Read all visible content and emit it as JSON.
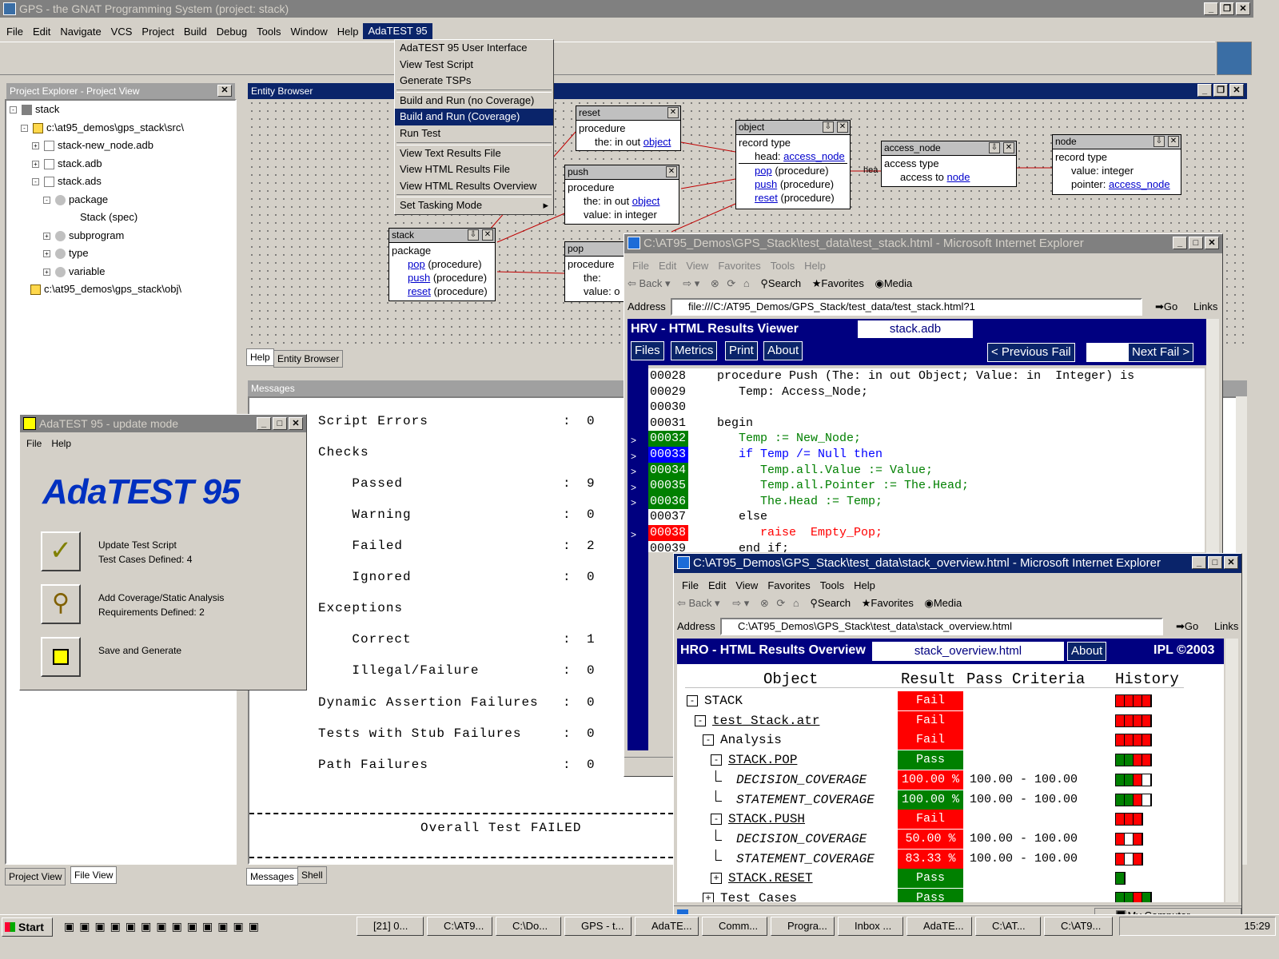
{
  "gps": {
    "title": "GPS - the GNAT Programming System (project: stack)",
    "menu": [
      "File",
      "Edit",
      "Navigate",
      "VCS",
      "Project",
      "Build",
      "Debug",
      "Tools",
      "Window",
      "Help",
      "AdaTEST 95"
    ]
  },
  "adatest_menu": {
    "items": [
      "AdaTEST 95 User Interface",
      "View Test Script",
      "Generate TSPs",
      "Build and Run (no Coverage)",
      "Build and Run (Coverage)",
      "Run Test",
      "View Text Results File",
      "View HTML Results File",
      "View HTML Results Overview",
      "Set Tasking Mode"
    ]
  },
  "project_explorer": {
    "title": "Project Explorer - Project View",
    "tree": [
      "stack",
      "c:\\at95_demos\\gps_stack\\src\\",
      "stack-new_node.adb",
      "stack.adb",
      "stack.ads",
      "package",
      "Stack (spec)",
      "subprogram",
      "type",
      "variable",
      "c:\\at95_demos\\gps_stack\\obj\\"
    ],
    "tabs": [
      "Project View",
      "File View"
    ]
  },
  "entity_browser": {
    "title": "Entity Browser",
    "tabs": [
      "Help",
      "Entity Browser"
    ],
    "boxes": {
      "reset": {
        "name": "reset",
        "kind": "procedure",
        "p1": "the: in out ",
        "p1t": "object"
      },
      "push": {
        "name": "push",
        "kind": "procedure",
        "p1": "the:   in out ",
        "p1t": "object",
        "p2": "value: in integer"
      },
      "pop": {
        "name": "pop",
        "kind": "procedure",
        "p1": "the:",
        "p2": "value: o"
      },
      "stack": {
        "name": "stack",
        "kind": "package",
        "items": [
          "pop",
          "push",
          "reset"
        ],
        "suffix": "(procedure)"
      },
      "object": {
        "name": "object",
        "kind": "record type",
        "head": "head: ",
        "headt": "access_node",
        "items": [
          "pop",
          "push",
          "reset"
        ],
        "suffix": "(procedure)"
      },
      "access_node": {
        "name": "access_node",
        "kind": "access type",
        "to": "access to ",
        "tot": "node"
      },
      "node": {
        "name": "node",
        "kind": "record type",
        "v": "value:   integer",
        "p": "pointer: ",
        "pt": "access_node"
      },
      "edge_label": "hea"
    }
  },
  "messages": {
    "title": "Messages",
    "rows": [
      {
        "label": "Script Errors",
        "sep": ":",
        "val": "0"
      },
      {
        "label": "Checks",
        "sep": "",
        "val": ""
      },
      {
        "label": "    Passed",
        "sep": ":",
        "val": "9"
      },
      {
        "label": "    Warning",
        "sep": ":",
        "val": "0"
      },
      {
        "label": "    Failed",
        "sep": ":",
        "val": "2"
      },
      {
        "label": "    Ignored",
        "sep": ":",
        "val": "0"
      },
      {
        "label": "Exceptions",
        "sep": "",
        "val": ""
      },
      {
        "label": "    Correct",
        "sep": ":",
        "val": "1"
      },
      {
        "label": "    Illegal/Failure",
        "sep": ":",
        "val": "0"
      },
      {
        "label": "Dynamic Assertion Failures",
        "sep": ":",
        "val": "0"
      },
      {
        "label": "Tests with Stub Failures",
        "sep": ":",
        "val": "0"
      },
      {
        "label": "Path Failures",
        "sep": ":",
        "val": "0"
      }
    ],
    "overall": "Overall Test FAILED",
    "tabs": [
      "Messages",
      "Shell"
    ]
  },
  "adatest": {
    "title": "AdaTEST 95 - update mode",
    "menu": [
      "File",
      "Help"
    ],
    "logo": "AdaTEST 95",
    "actions": [
      {
        "l1": "Update Test Script",
        "l2": "Test Cases Defined: 4"
      },
      {
        "l1": "Add Coverage/Static Analysis",
        "l2": "Requirements Defined: 2"
      },
      {
        "l1": "Save and Generate",
        "l2": ""
      }
    ]
  },
  "ie1": {
    "title": "C:\\AT95_Demos\\GPS_Stack\\test_data\\test_stack.html - Microsoft Internet Explorer",
    "menu": [
      "File",
      "Edit",
      "View",
      "Favorites",
      "Tools",
      "Help"
    ],
    "tb": {
      "back": "Back",
      "search": "Search",
      "favorites": "Favorites",
      "media": "Media"
    },
    "address_label": "Address",
    "address": "file:///C:/AT95_Demos/GPS_Stack/test_data/test_stack.html?1",
    "go": "Go",
    "links": "Links",
    "hrv": "HRV - HTML Results Viewer",
    "file": "stack.adb",
    "buttons": [
      "Files",
      "Metrics",
      "Print",
      "About"
    ],
    "prev": "< Previous Fail",
    "next": "Next Fail >",
    "code": [
      {
        "n": "00028",
        "c": "",
        "t": "    procedure Push (The: in out Object; Value: in  Integer) is",
        "cls": ""
      },
      {
        "n": "00029",
        "c": "",
        "t": "       Temp: Access_Node;",
        "cls": ""
      },
      {
        "n": "00030",
        "c": "",
        "t": "",
        "cls": ""
      },
      {
        "n": "00031",
        "c": "",
        "t": "    begin",
        "cls": ""
      },
      {
        "n": "00032",
        "c": "g",
        "t": "       Temp := New_Node;",
        "cls": "gr"
      },
      {
        "n": "00033",
        "c": "b",
        "t": "       if Temp /= Null then",
        "cls": "kw"
      },
      {
        "n": "00034",
        "c": "g",
        "t": "          Temp.all.Value := Value;",
        "cls": "gr"
      },
      {
        "n": "00035",
        "c": "g",
        "t": "          Temp.all.Pointer := The.Head;",
        "cls": "gr"
      },
      {
        "n": "00036",
        "c": "g",
        "t": "          The.Head := Temp;",
        "cls": "gr"
      },
      {
        "n": "00037",
        "c": "",
        "t": "       else",
        "cls": ""
      },
      {
        "n": "00038",
        "c": "r",
        "t": "          raise  Empty_Pop;",
        "cls": "rd"
      },
      {
        "n": "00039",
        "c": "",
        "t": "       end if;",
        "cls": ""
      }
    ]
  },
  "ie2": {
    "title": "C:\\AT95_Demos\\GPS_Stack\\test_data\\stack_overview.html - Microsoft Internet Explorer",
    "menu": [
      "File",
      "Edit",
      "View",
      "Favorites",
      "Tools",
      "Help"
    ],
    "address": "C:\\AT95_Demos\\GPS_Stack\\test_data\\stack_overview.html",
    "hro": "HRO - HTML Results Overview",
    "file": "stack_overview.html",
    "about": "About",
    "ipl": "IPL ©2003",
    "headers": [
      "Object",
      "Result",
      "Pass Criteria",
      "History"
    ],
    "rows": [
      {
        "obj": "STACK",
        "res": "Fail",
        "pc": "",
        "ind": 0,
        "exp": "-",
        "rc": "f",
        "it": false,
        "hist": [
          "r",
          "r",
          "r",
          "r"
        ]
      },
      {
        "obj": "test_Stack.atr",
        "res": "Fail",
        "pc": "",
        "ind": 1,
        "exp": "-",
        "rc": "f",
        "it": false,
        "hist": [
          "r",
          "r",
          "r",
          "r"
        ]
      },
      {
        "obj": "Analysis",
        "res": "Fail",
        "pc": "",
        "ind": 2,
        "exp": "-",
        "rc": "f",
        "it": false,
        "hist": [
          "r",
          "r",
          "r",
          "r"
        ]
      },
      {
        "obj": "STACK.POP",
        "res": "Pass",
        "pc": "",
        "ind": 3,
        "exp": "-",
        "rc": "p",
        "it": false,
        "hist": [
          "g",
          "g",
          "r",
          "r"
        ]
      },
      {
        "obj": "DECISION_COVERAGE",
        "res": "100.00 %",
        "pc": "100.00  -  100.00",
        "ind": 4,
        "exp": "",
        "rc": "f",
        "it": true,
        "hist": [
          "g",
          "g",
          "r",
          "w"
        ]
      },
      {
        "obj": "STATEMENT_COVERAGE",
        "res": "100.00 %",
        "pc": "100.00  -  100.00",
        "ind": 4,
        "exp": "",
        "rc": "p",
        "it": true,
        "hist": [
          "g",
          "g",
          "r",
          "w"
        ]
      },
      {
        "obj": "STACK.PUSH",
        "res": "Fail",
        "pc": "",
        "ind": 3,
        "exp": "-",
        "rc": "f",
        "it": false,
        "hist": [
          "r",
          "r",
          "r"
        ]
      },
      {
        "obj": "DECISION_COVERAGE",
        "res": "50.00 %",
        "pc": "100.00  -  100.00",
        "ind": 4,
        "exp": "",
        "rc": "f",
        "it": true,
        "hist": [
          "r",
          "w",
          "r"
        ]
      },
      {
        "obj": "STATEMENT_COVERAGE",
        "res": "83.33 %",
        "pc": "100.00  -  100.00",
        "ind": 4,
        "exp": "",
        "rc": "f",
        "it": true,
        "hist": [
          "r",
          "w",
          "r"
        ]
      },
      {
        "obj": "STACK.RESET",
        "res": "Pass",
        "pc": "",
        "ind": 3,
        "exp": "+",
        "rc": "p",
        "it": false,
        "hist": [
          "g"
        ]
      },
      {
        "obj": "Test Cases",
        "res": "Pass",
        "pc": "",
        "ind": 2,
        "exp": "+",
        "rc": "p",
        "it": false,
        "hist": [
          "g",
          "g",
          "r",
          "g"
        ]
      }
    ],
    "status": "My Computer"
  },
  "taskbar": {
    "start": "Start",
    "buttons": [
      "[21] 0...",
      "C:\\AT9...",
      "C:\\Do...",
      "GPS - t...",
      "AdaTE...",
      "Comm...",
      "Progra...",
      "Inbox ...",
      "AdaTE...",
      "C:\\AT...",
      "C:\\AT9..."
    ],
    "clock": "15:29"
  }
}
